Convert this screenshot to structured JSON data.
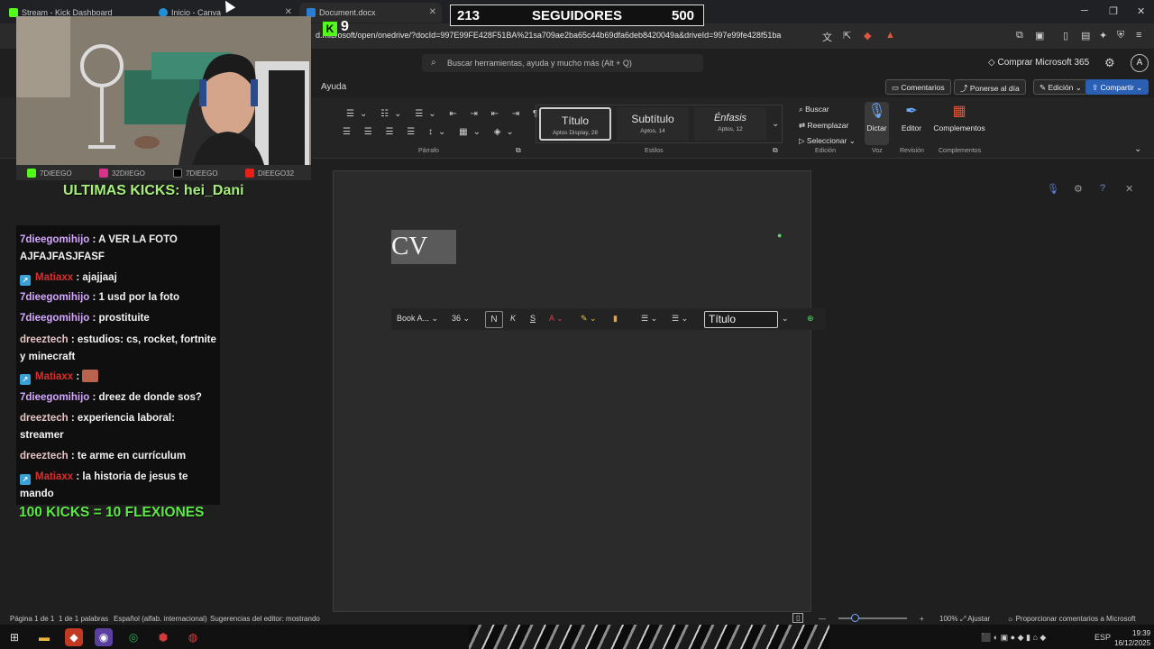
{
  "browser": {
    "tabs": [
      {
        "title": "Stream - Kick Dashboard"
      },
      {
        "title": "Inicio - Canva"
      },
      {
        "title": "Document.docx"
      }
    ],
    "url": "d.microsoft/open/onedrive/?docId=997E99FE428F51BA%21sa709ae2ba65c44b69dfa6deb8420049a&driveId=997e99fe428f51ba"
  },
  "word": {
    "search_placeholder": "Buscar herramientas, ayuda y mucho más (Alt + Q)",
    "buy_label": "Comprar Microsoft 365",
    "avatar_letter": "A",
    "menu_help": "Ayuda",
    "top_buttons": {
      "comments": "Comentarios",
      "catch_up": "Ponerse al día",
      "editing": "Edición",
      "share": "Compartir"
    },
    "ribbon": {
      "paragraph_label": "Párrafo",
      "styles_label": "Estilos",
      "styles": [
        {
          "name": "Título",
          "sub": "Aptos Display, 28"
        },
        {
          "name": "Subtítulo",
          "sub": "Aptos, 14"
        },
        {
          "name": "Énfasis",
          "sub": "Aptos, 12"
        }
      ],
      "find": "Buscar",
      "replace": "Reemplazar",
      "select": "Seleccionar",
      "editing_label": "Edición",
      "dictate": "Dictar",
      "voice_label": "Voz",
      "editor": "Editor",
      "review_label": "Revisión",
      "addins": "Complementos",
      "addins_label": "Complementos"
    },
    "document": {
      "heading_text": "CV"
    },
    "float_toolbar": {
      "font": "Book A...",
      "size": "36",
      "bold": "N",
      "style": "Título"
    },
    "status": {
      "page": "Página 1 de 1",
      "words": "1 de 1 palabras",
      "language": "Español (alfab. internacional)",
      "suggestions": "Sugerencias del editor: mostrando",
      "zoom": "100%",
      "fit": "Ajustar",
      "feedback": "Proporcionar comentarios a Microsoft"
    }
  },
  "overlay": {
    "counter": {
      "current": "213",
      "label": "SEGUIDORES",
      "goal": "500"
    },
    "kick_viewers": "9",
    "socials": [
      "7DIEEGO",
      "32DIIEGO",
      "7DIEEGO",
      "DIEEGO32"
    ],
    "last_kicks": "ULTIMAS KICKS: hei_Dani",
    "chat": [
      {
        "user": "7dieegomihijo",
        "text": " : A VER LA FOTO AJFAJFASJFASF",
        "style": "purple",
        "badge": false
      },
      {
        "user": "Matiaxx",
        "text": " : ajajjaaj",
        "style": "red",
        "badge": true
      },
      {
        "user": "7dieegomihijo",
        "text": " : 1 usd por la foto",
        "style": "purple",
        "badge": false
      },
      {
        "user": "7dieegomihijo",
        "text": " : prostituite",
        "style": "purple",
        "badge": false
      },
      {
        "user": "dreeztech",
        "text": " : estudios: cs, rocket, fortnite y minecraft",
        "style": "pink",
        "badge": false
      },
      {
        "user": "Matiaxx",
        "text": " : ",
        "style": "red",
        "badge": true
      },
      {
        "user": "7dieegomihijo",
        "text": " : dreez de donde sos?",
        "style": "purple",
        "badge": false
      },
      {
        "user": "dreeztech",
        "text": " : experiencia laboral: streamer",
        "style": "pink",
        "badge": false
      },
      {
        "user": "dreeztech",
        "text": " : te arme en currículum",
        "style": "pink",
        "badge": false
      },
      {
        "user": "Matiaxx",
        "text": " : la historia de jesus te mando",
        "style": "red",
        "badge": true
      }
    ],
    "kick_goal": "100 KICKS = 10 FLEXIONES"
  },
  "taskbar": {
    "lang": "ESP",
    "time": "19:39",
    "date": "16/12/2025"
  }
}
